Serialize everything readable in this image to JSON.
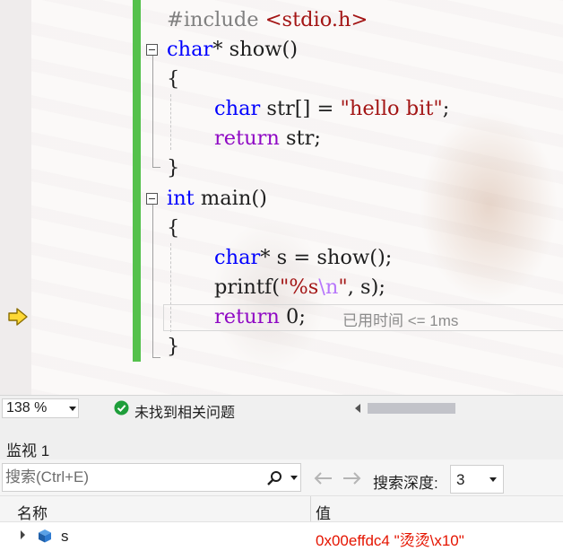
{
  "editor": {
    "lines": {
      "l1": {
        "directive": "#include ",
        "header": "<stdio.h>"
      },
      "l2": {
        "type": "char",
        "rest": "* show()"
      },
      "l3": {
        "text": "{"
      },
      "l4": {
        "type": "char",
        "mid": " str[] = ",
        "string": "\"hello bit\"",
        "end": ";"
      },
      "l5": {
        "keyword": "return",
        "rest": " str;"
      },
      "l6": {
        "text": "}"
      },
      "l7": {
        "keyword": "int",
        "rest": " main()"
      },
      "l8": {
        "text": "{"
      },
      "l9": {
        "type": "char",
        "rest": "* s = show();"
      },
      "l10": {
        "func": "printf(",
        "str_a": "\"%s",
        "escape": "\\n",
        "str_b": "\"",
        "rest": ", s);"
      },
      "l11": {
        "keyword": "return",
        "rest": " 0;"
      },
      "l12": {
        "text": "}"
      }
    },
    "perf_tip": "已用时间 <= 1ms"
  },
  "status_bar": {
    "zoom": "138 %",
    "issues_text": "未找到相关问题"
  },
  "watch": {
    "title": "监视 1",
    "search_placeholder": "搜索(Ctrl+E)",
    "depth_label": "搜索深度:",
    "depth_value": "3",
    "columns": {
      "name": "名称",
      "value": "值"
    },
    "rows": [
      {
        "name": "s",
        "value": "0x00effdc4 \"烫烫\\x10\""
      }
    ]
  },
  "colors": {
    "keyword": "#0000ff",
    "type": "#8f08c4",
    "string": "#a31515",
    "change_bar": "#55c14c",
    "error_value": "#e51400"
  }
}
